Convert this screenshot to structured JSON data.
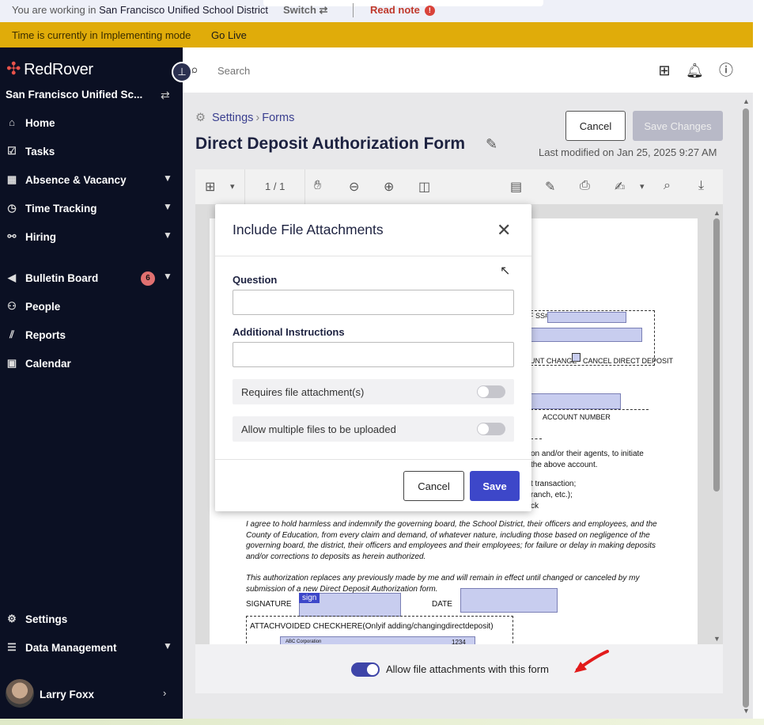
{
  "topbar": {
    "context_prefix": "You are working in",
    "district": "San Francisco Unified School District",
    "switch_label": "Switch",
    "read_note_label": "Read note"
  },
  "modebar": {
    "text": "Time is currently in Implementing mode",
    "go_live": "Go Live"
  },
  "sidebar": {
    "brand": "RedRover",
    "district_short": "San Francisco Unified Sc...",
    "items": [
      {
        "label": "Home",
        "icon": "home-icon"
      },
      {
        "label": "Tasks",
        "icon": "tasks-icon"
      },
      {
        "label": "Absence & Vacancy",
        "icon": "calendar-grid-icon"
      },
      {
        "label": "Time Tracking",
        "icon": "clock-icon"
      },
      {
        "label": "Hiring",
        "icon": "handshake-icon"
      },
      {
        "label": "Bulletin Board",
        "icon": "megaphone-icon",
        "badge": "6"
      },
      {
        "label": "People",
        "icon": "people-icon"
      },
      {
        "label": "Reports",
        "icon": "chart-icon"
      },
      {
        "label": "Calendar",
        "icon": "calendar-icon"
      }
    ],
    "settings": "Settings",
    "data_management": "Data Management",
    "user": "Larry Foxx"
  },
  "header": {
    "search_placeholder": "Search"
  },
  "page": {
    "breadcrumb_settings": "Settings",
    "breadcrumb_forms": "Forms",
    "title": "Direct Deposit Authorization Form",
    "cancel": "Cancel",
    "save_changes": "Save Changes",
    "last_modified": "Last modified on Jan 25, 2025 9:27 AM"
  },
  "viewer": {
    "page_indicator": "1 / 1"
  },
  "document": {
    "ssn_label": "F SS#",
    "account_change": "UNT CHANGE",
    "cancel_deposit": "CANCEL DIRECT DEPOSIT",
    "account_number": "ACCOUNT NUMBER",
    "auth_line1": "on and/or their agents, to initiate",
    "auth_line2": "the above account.",
    "list_line1": "t transaction;",
    "list_line2": "ranch, etc.);",
    "list_line3": "ck",
    "hold_harmless": [
      "I agree to hold harmless and indemnify the governing board, the School District, their officers and employees, and the",
      "County of Education, from every claim and demand, of whatever nature, including those based on negligence of the",
      "governing board, the district, their officers and employees and their employees; for failure or delay in making deposits",
      "and/or corrections to deposits as herein authorized."
    ],
    "replaces": [
      "This authorization replaces any previously made by me and will remain in effect until changed or canceled by my",
      "submission of a new Direct Deposit Authorization form."
    ],
    "signature": "SIGNATURE",
    "sign_tag": "sign",
    "date": "DATE",
    "attach_check": "ATTACHVOIDED CHECKHERE(Onlyif adding/changingdirectdeposit)",
    "check_company": "ABC Corporation",
    "check_number": "1234"
  },
  "footer": {
    "toggle_label": "Allow file attachments with this form",
    "toggle_on": true
  },
  "modal": {
    "title": "Include File Attachments",
    "question_label": "Question",
    "question_value": "",
    "instructions_label": "Additional Instructions",
    "instructions_value": "",
    "requires_label": "Requires file attachment(s)",
    "requires_on": false,
    "multiple_label": "Allow multiple files to be uploaded",
    "multiple_on": false,
    "cancel": "Cancel",
    "save": "Save"
  },
  "colors": {
    "sidebar_bg": "#0b1023",
    "mode_banner": "#e0ac0a",
    "primary": "#3d47c9",
    "brand_red": "#e8524a"
  }
}
